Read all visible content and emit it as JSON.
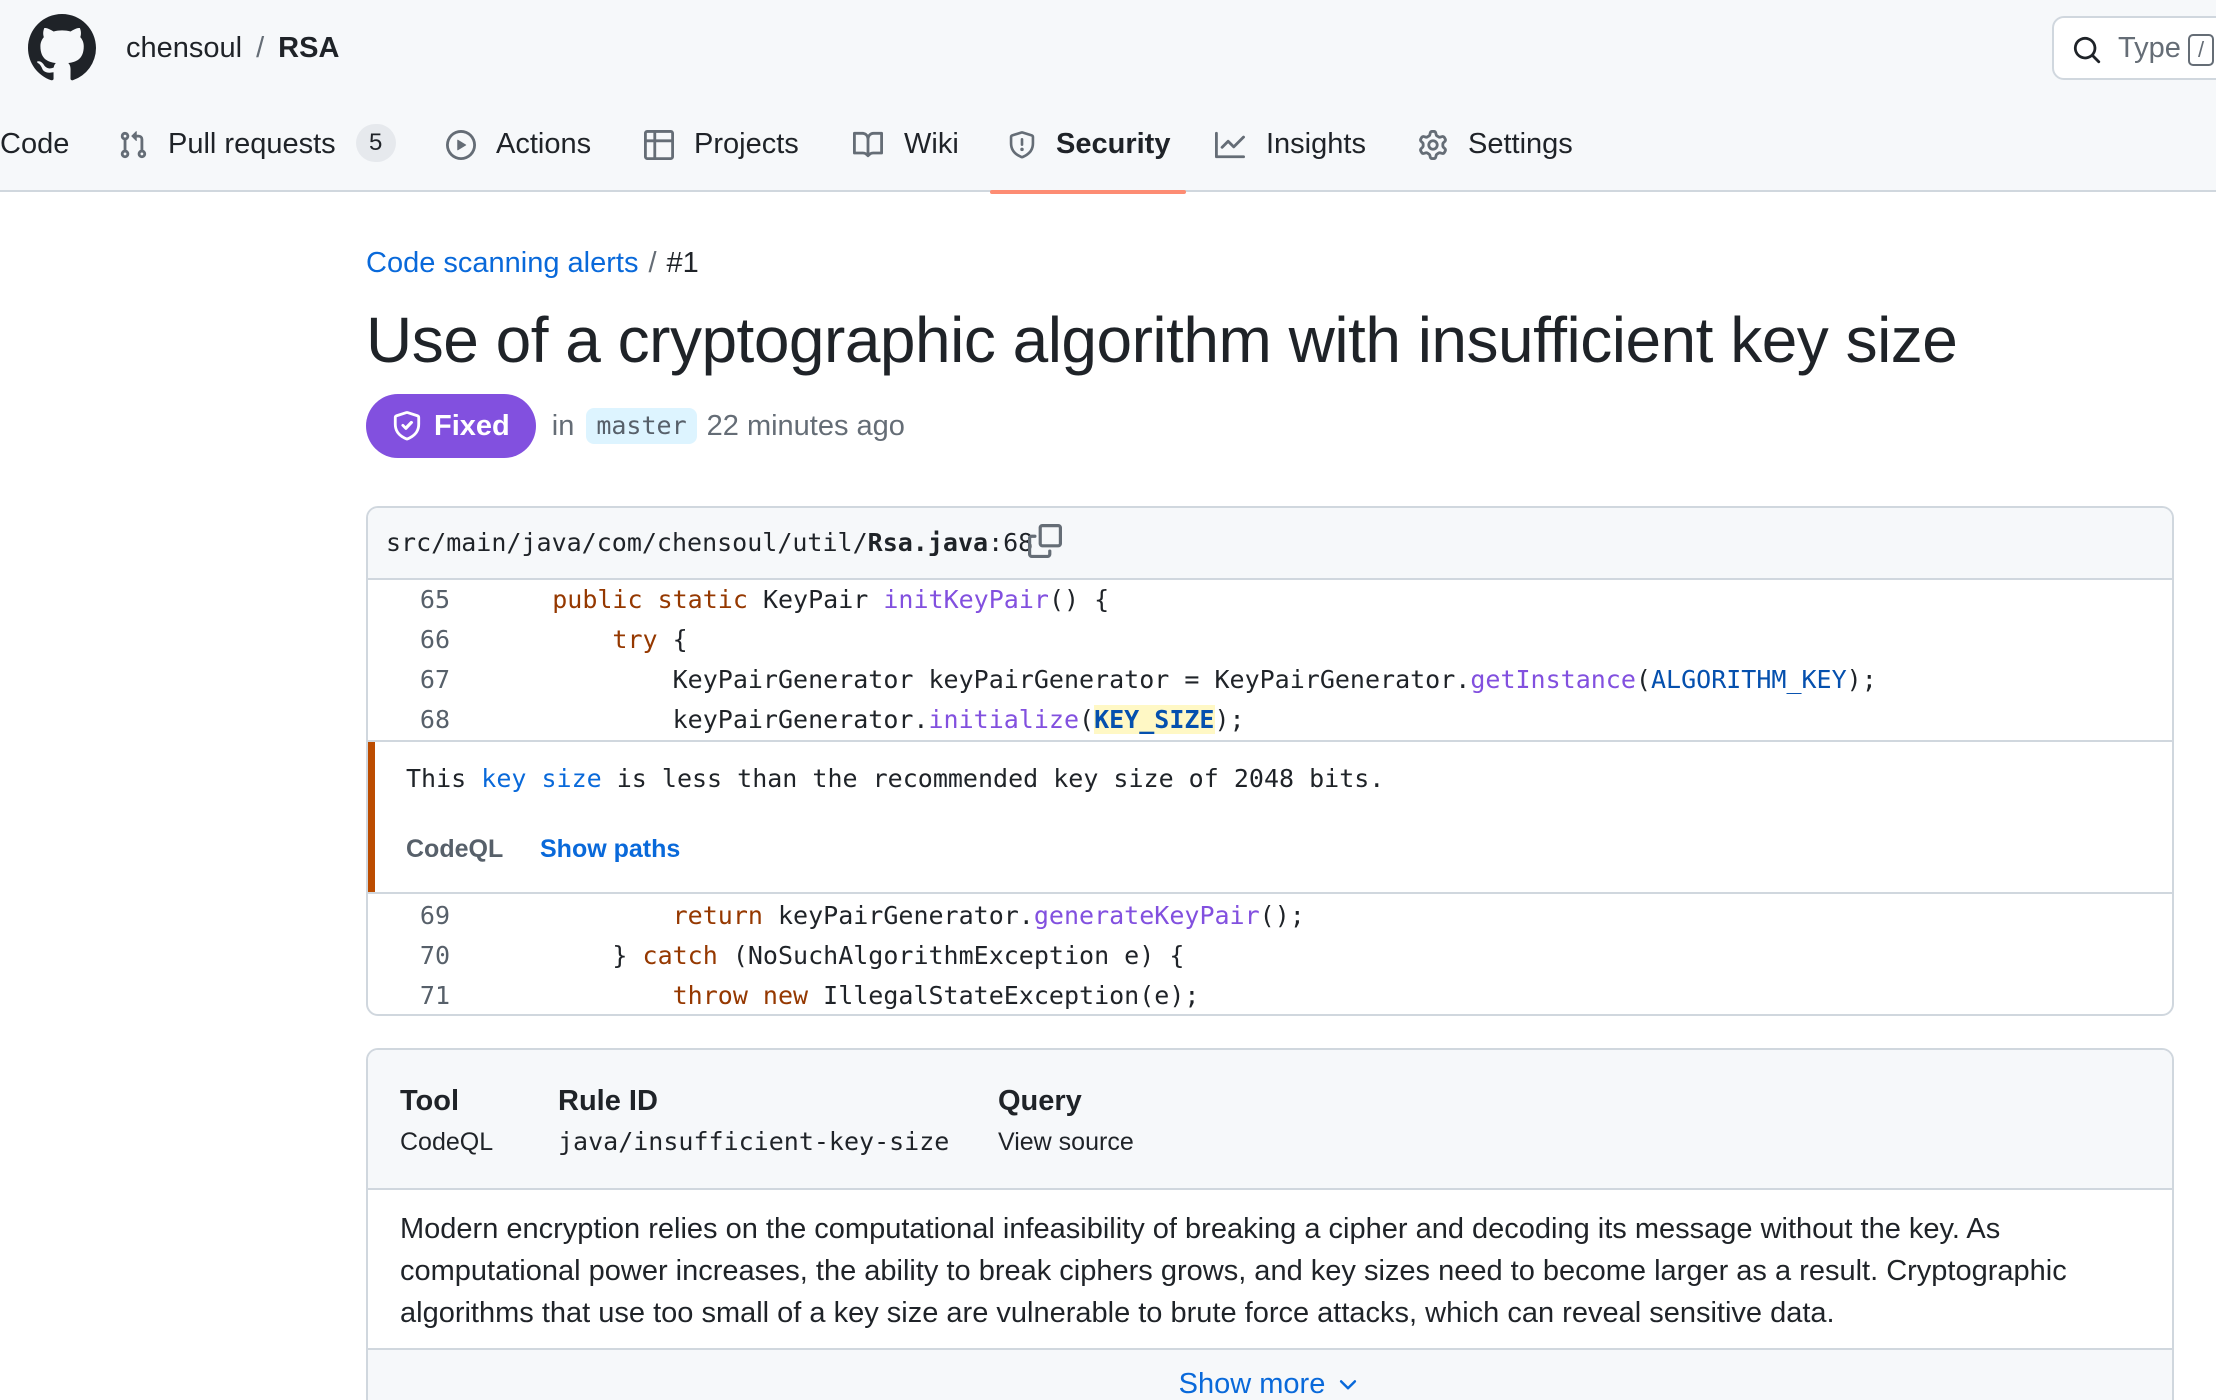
{
  "repo": {
    "owner": "chensoul",
    "separator": "/",
    "name": "RSA"
  },
  "search": {
    "placeholder": "Type",
    "shortcut": "/"
  },
  "nav": {
    "code": "Code",
    "pull_requests": "Pull requests",
    "pull_requests_count": "5",
    "actions": "Actions",
    "projects": "Projects",
    "wiki": "Wiki",
    "security": "Security",
    "insights": "Insights",
    "settings": "Settings",
    "active": "Security"
  },
  "breadcrumb": {
    "parent": "Code scanning alerts",
    "separator": "/",
    "current": "#1"
  },
  "alert": {
    "title": "Use of a cryptographic algorithm with insufficient key size",
    "status": "Fixed",
    "in_label": "in",
    "branch": "master",
    "time_ago": "22 minutes ago"
  },
  "code": {
    "file_path": "src/main/java/com/chensoul/util/",
    "file_name": "Rsa.java",
    "line_ref": ":68",
    "lines_before": [
      {
        "num": "65",
        "tokens": [
          {
            "t": "    "
          },
          {
            "t": "public static",
            "c": "kw"
          },
          {
            "t": " KeyPair "
          },
          {
            "t": "initKeyPair",
            "c": "fn"
          },
          {
            "t": "() {"
          }
        ]
      },
      {
        "num": "66",
        "tokens": [
          {
            "t": "        "
          },
          {
            "t": "try",
            "c": "kw"
          },
          {
            "t": " {"
          }
        ]
      },
      {
        "num": "67",
        "tokens": [
          {
            "t": "            KeyPairGenerator keyPairGenerator = KeyPairGenerator."
          },
          {
            "t": "getInstance",
            "c": "fn"
          },
          {
            "t": "("
          },
          {
            "t": "ALGORITHM_KEY",
            "c": "cst"
          },
          {
            "t": ");"
          }
        ]
      },
      {
        "num": "68",
        "tokens": [
          {
            "t": "            keyPairGenerator."
          },
          {
            "t": "initialize",
            "c": "fn"
          },
          {
            "t": "("
          },
          {
            "t": "KEY_SIZE",
            "c": "hl"
          },
          {
            "t": ");"
          }
        ]
      }
    ],
    "lines_after": [
      {
        "num": "69",
        "tokens": [
          {
            "t": "            "
          },
          {
            "t": "return",
            "c": "kw"
          },
          {
            "t": " keyPairGenerator."
          },
          {
            "t": "generateKeyPair",
            "c": "fn"
          },
          {
            "t": "();"
          }
        ]
      },
      {
        "num": "70",
        "tokens": [
          {
            "t": "        } "
          },
          {
            "t": "catch",
            "c": "kw"
          },
          {
            "t": " (NoSuchAlgorithmException e) {"
          }
        ]
      },
      {
        "num": "71",
        "tokens": [
          {
            "t": "            "
          },
          {
            "t": "throw new",
            "c": "kw"
          },
          {
            "t": " IllegalStateException(e);"
          }
        ]
      }
    ]
  },
  "annotation": {
    "msg_pre": "This ",
    "msg_link": "key size",
    "msg_post": " is less than the recommended key size of 2048 bits.",
    "tool": "CodeQL",
    "show_paths": "Show paths"
  },
  "info": {
    "tool_label": "Tool",
    "tool_value": "CodeQL",
    "rule_label": "Rule ID",
    "rule_value": "java/insufficient-key-size",
    "query_label": "Query",
    "query_value": "View source",
    "description": "Modern encryption relies on the computational infeasibility of breaking a cipher and decoding its message without the key. As computational power increases, the ability to break ciphers grows, and key sizes need to become larger as a result. Cryptographic algorithms that use too small of a key size are vulnerable to brute force attacks, which can reveal sensitive data.",
    "show_more": "Show more"
  },
  "colors": {
    "accent": "#0969da",
    "fixed_purple": "#8250df",
    "alert_bar": "#bc4c00",
    "tab_underline": "#fd8c73"
  }
}
